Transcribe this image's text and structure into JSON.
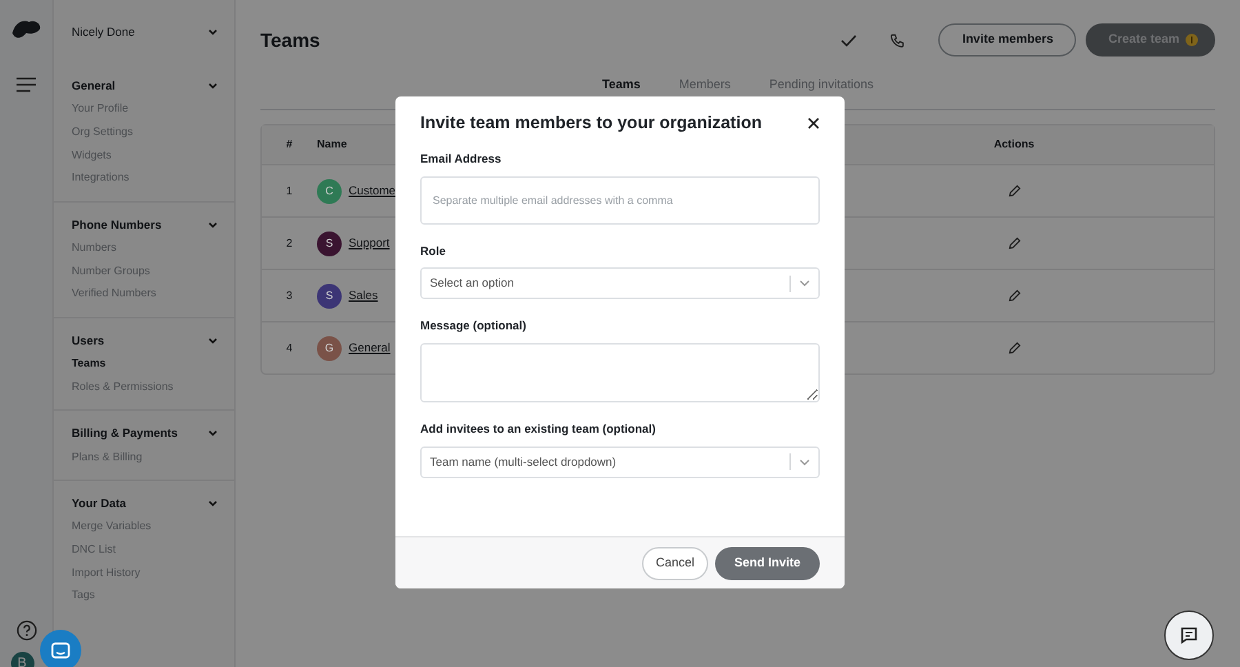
{
  "org": {
    "name": "Nicely Done"
  },
  "sidebar": {
    "sections": [
      {
        "title": "General",
        "items": [
          {
            "label": "Your Profile",
            "selected": false
          },
          {
            "label": "Org Settings",
            "selected": false
          },
          {
            "label": "Widgets",
            "selected": false
          },
          {
            "label": "Integrations",
            "selected": false
          }
        ]
      },
      {
        "title": "Phone Numbers",
        "items": [
          {
            "label": "Numbers",
            "selected": false
          },
          {
            "label": "Number Groups",
            "selected": false
          },
          {
            "label": "Verified Numbers",
            "selected": false
          }
        ]
      },
      {
        "title": "Users",
        "items": [
          {
            "label": "Teams",
            "selected": true
          },
          {
            "label": "Roles & Permissions",
            "selected": false
          }
        ]
      },
      {
        "title": "Billing & Payments",
        "items": [
          {
            "label": "Plans & Billing",
            "selected": false
          }
        ]
      },
      {
        "title": "Your Data",
        "items": [
          {
            "label": "Merge Variables",
            "selected": false
          },
          {
            "label": "DNC List",
            "selected": false
          },
          {
            "label": "Import History",
            "selected": false
          },
          {
            "label": "Tags",
            "selected": false
          }
        ]
      }
    ]
  },
  "user_avatar": "B",
  "page": {
    "title": "Teams",
    "buttons": [
      "Invite members",
      "Create team"
    ]
  },
  "tabs": [
    {
      "label": "Teams",
      "selected": true
    },
    {
      "label": "Members",
      "selected": false
    },
    {
      "label": "Pending invitations",
      "selected": false
    }
  ],
  "table": {
    "columns": [
      "#",
      "Name",
      "Actions"
    ],
    "rows": [
      {
        "index": "1",
        "initial": "C",
        "color": "#2f7a55",
        "name": "Custome"
      },
      {
        "index": "2",
        "initial": "S",
        "color": "#3a1430",
        "name": "Support"
      },
      {
        "index": "3",
        "initial": "S",
        "color": "#3c3575",
        "name": "Sales"
      },
      {
        "index": "4",
        "initial": "G",
        "color": "#7a5248",
        "name": "General"
      }
    ]
  },
  "modal": {
    "title": "Invite team members to your organization",
    "fields": [
      {
        "kind": "text",
        "label": "Email Address",
        "placeholder": "Separate multiple email addresses with a comma"
      },
      {
        "kind": "select",
        "label": "Role",
        "placeholder": "Select an option"
      },
      {
        "kind": "textarea",
        "label": "Message (optional)"
      },
      {
        "kind": "select",
        "label": "Add invitees to an existing team (optional)",
        "placeholder": "Team name (multi-select dropdown)"
      }
    ],
    "buttons": [
      "Cancel",
      "Send Invite"
    ]
  }
}
